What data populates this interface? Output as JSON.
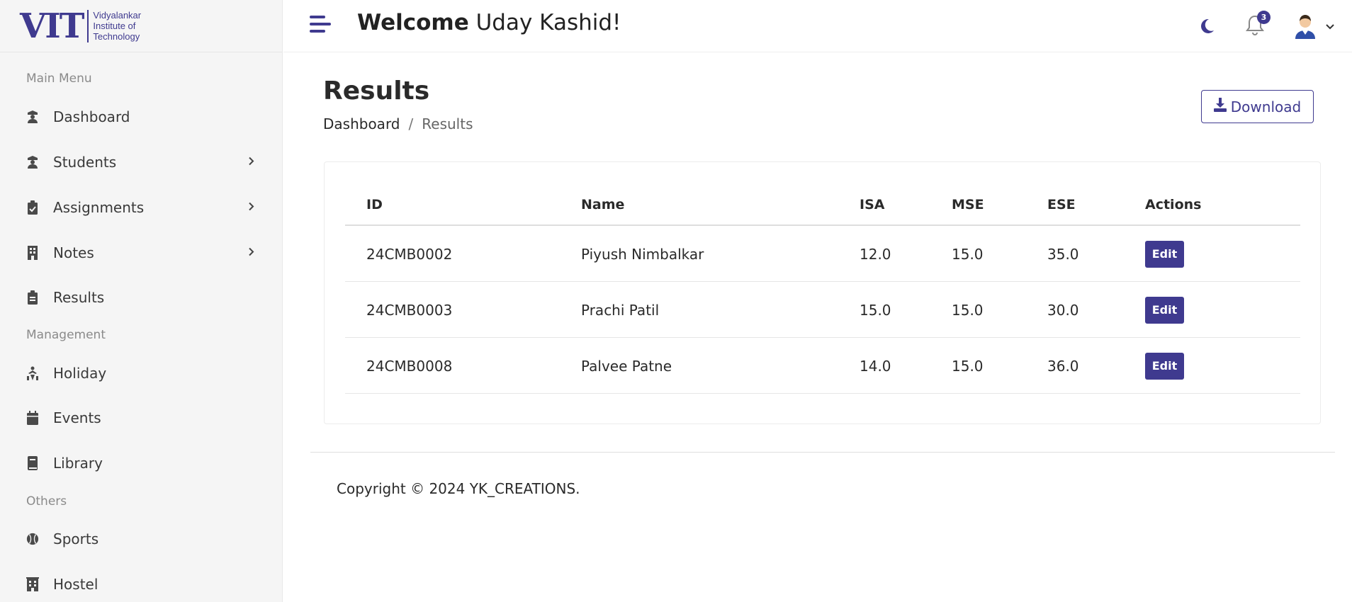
{
  "brand": {
    "logo_letters": "VIT",
    "logo_line1": "Vidyalankar",
    "logo_line2": "Institute of",
    "logo_line3": "Technology",
    "accent_color": "#3f3a8f"
  },
  "sidebar": {
    "sections": [
      "Main Menu",
      "Management",
      "Others"
    ],
    "items": [
      {
        "label": "Dashboard",
        "icon": "graduate-icon"
      },
      {
        "label": "Students",
        "icon": "graduate-icon"
      },
      {
        "label": "Assignments",
        "icon": "clipboard-check-icon"
      },
      {
        "label": "Notes",
        "icon": "building-icon"
      },
      {
        "label": "Results",
        "icon": "clipboard-list-icon"
      },
      {
        "label": "Holiday",
        "icon": "holiday-icon"
      },
      {
        "label": "Events",
        "icon": "calendar-icon"
      },
      {
        "label": "Library",
        "icon": "book-icon"
      },
      {
        "label": "Sports",
        "icon": "baseball-icon"
      },
      {
        "label": "Hostel",
        "icon": "hotel-icon"
      }
    ]
  },
  "header": {
    "welcome_bold": "Welcome",
    "user_name": "Uday Kashid!",
    "notification_count": "3"
  },
  "main": {
    "title": "Results",
    "breadcrumb": [
      "Dashboard",
      "/",
      "Results"
    ],
    "download_label": "Download"
  },
  "table": {
    "columns": [
      "ID",
      "Name",
      "ISA",
      "MSE",
      "ESE",
      "Actions"
    ],
    "rows": [
      {
        "id": "24CMB0002",
        "name": "Piyush Nimbalkar",
        "isa": "12.0",
        "mse": "15.0",
        "ese": "35.0",
        "action": "Edit"
      },
      {
        "id": "24CMB0003",
        "name": "Prachi Patil",
        "isa": "15.0",
        "mse": "15.0",
        "ese": "30.0",
        "action": "Edit"
      },
      {
        "id": "24CMB0008",
        "name": "Palvee Patne",
        "isa": "14.0",
        "mse": "15.0",
        "ese": "36.0",
        "action": "Edit"
      }
    ]
  },
  "footer": {
    "copyright": "Copyright © 2024 YK_CREATIONS."
  }
}
